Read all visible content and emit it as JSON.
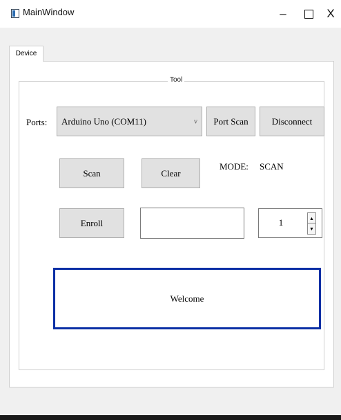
{
  "window": {
    "title": "MainWindow",
    "minimize_glyph": "–",
    "close_glyph": "X"
  },
  "tabs": [
    {
      "label": "Device",
      "active": true
    }
  ],
  "group": {
    "title": "Tool"
  },
  "ports": {
    "label": "Ports:",
    "selected": "Arduino Uno (COM11)",
    "dropdown_glyph": "v"
  },
  "buttons": {
    "port_scan": "Port Scan",
    "disconnect": "Disconnect",
    "scan": "Scan",
    "clear": "Clear",
    "enroll": "Enroll"
  },
  "mode": {
    "label": "MODE:",
    "value": "SCAN"
  },
  "enroll_input": {
    "value": ""
  },
  "spin": {
    "value": "1",
    "up_glyph": "▲",
    "down_glyph": "▼"
  },
  "display": {
    "text": "Welcome"
  },
  "colors": {
    "display_border": "#0b2fa5",
    "window_bg": "#f0f0f0"
  }
}
